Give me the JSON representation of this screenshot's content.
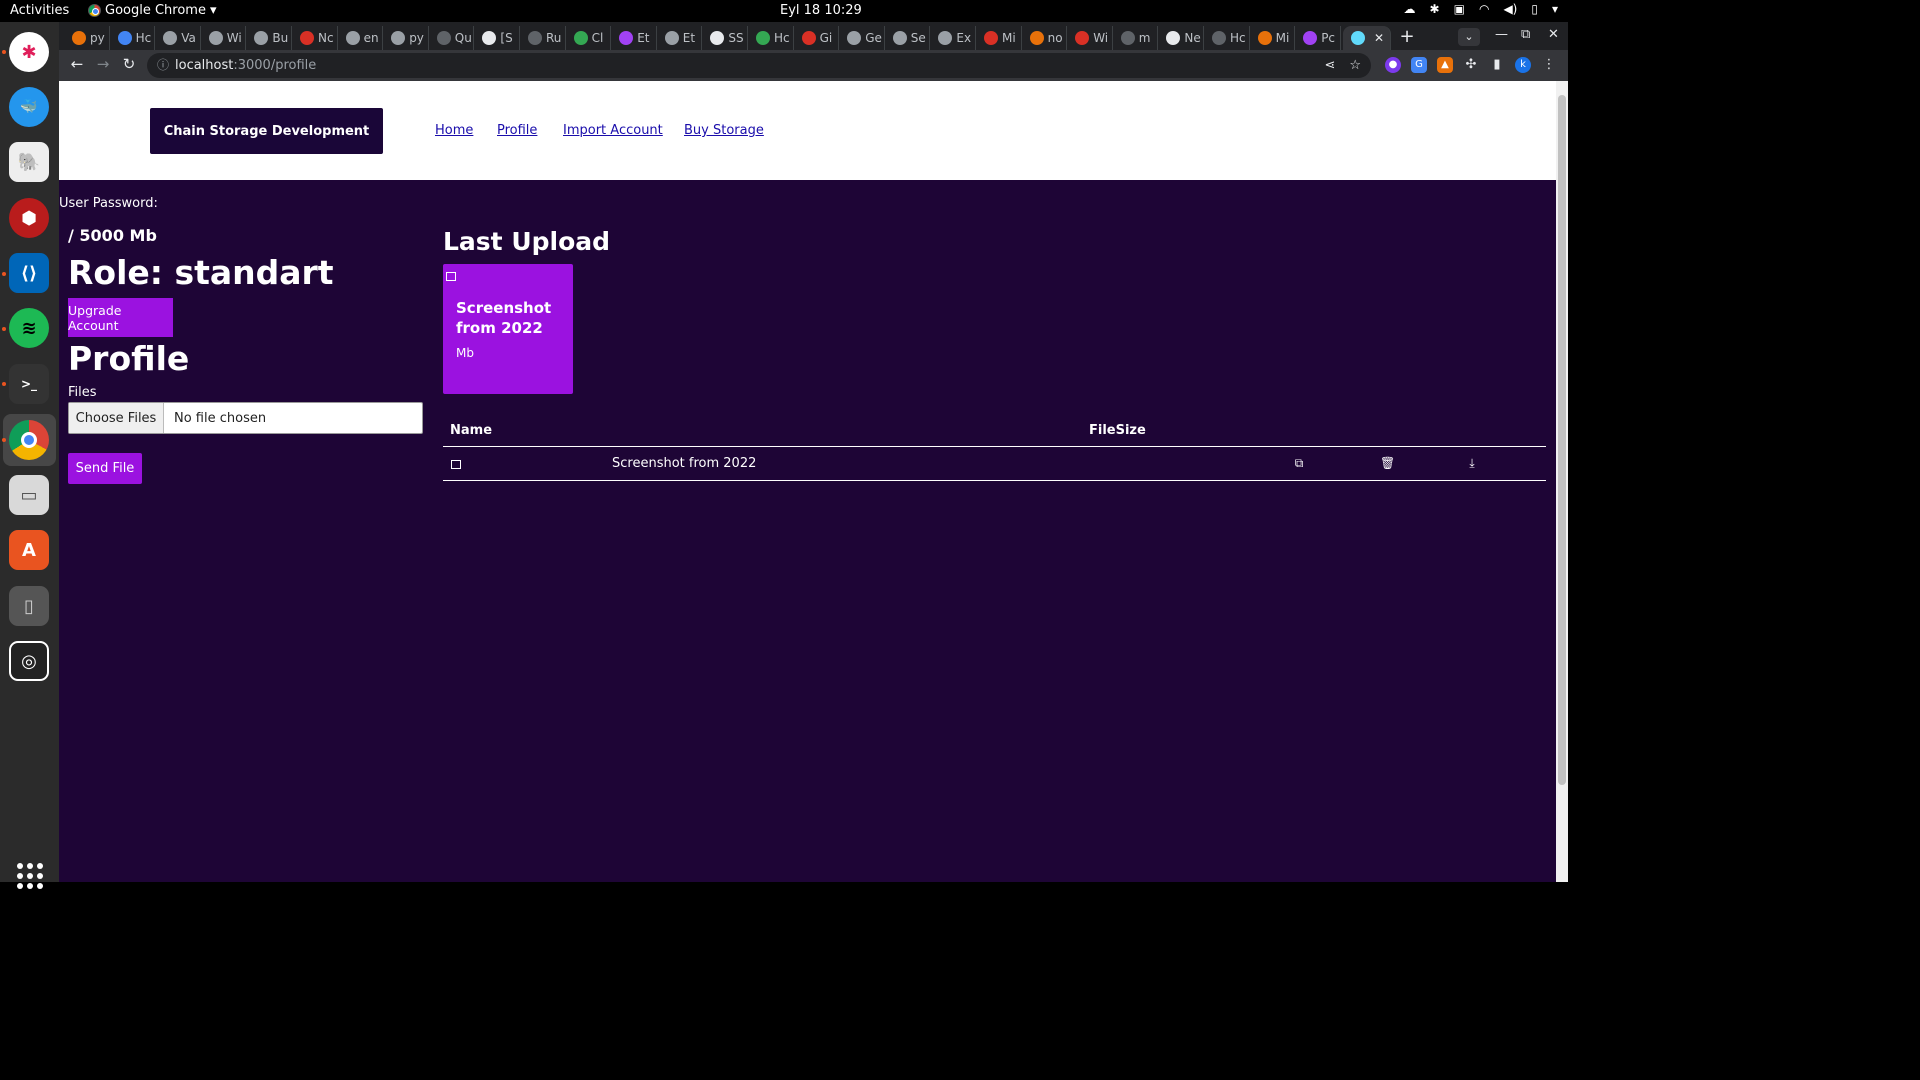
{
  "topbar": {
    "activities": "Activities",
    "app_name": "Google Chrome",
    "clock": "Eyl 18  10:29"
  },
  "browser": {
    "tabs": [
      {
        "label": "py",
        "color": "#e8710a"
      },
      {
        "label": "Hc",
        "color": "#4285f4"
      },
      {
        "label": "Va",
        "color": "#9aa0a6"
      },
      {
        "label": "Wi",
        "color": "#9aa0a6"
      },
      {
        "label": "Bu",
        "color": "#9aa0a6"
      },
      {
        "label": "Nc",
        "color": "#d93025"
      },
      {
        "label": "en",
        "color": "#9aa0a6"
      },
      {
        "label": "py",
        "color": "#9aa0a6"
      },
      {
        "label": "Qu",
        "color": "#5f6368"
      },
      {
        "label": "[S",
        "color": "#e8eaed"
      },
      {
        "label": "Ru",
        "color": "#5f6368"
      },
      {
        "label": "Cl",
        "color": "#34a853"
      },
      {
        "label": "Et",
        "color": "#a142f4"
      },
      {
        "label": "Et",
        "color": "#9aa0a6"
      },
      {
        "label": "SS",
        "color": "#e8eaed"
      },
      {
        "label": "Hc",
        "color": "#34a853"
      },
      {
        "label": "Gi",
        "color": "#d93025"
      },
      {
        "label": "Ge",
        "color": "#9aa0a6"
      },
      {
        "label": "Se",
        "color": "#9aa0a6"
      },
      {
        "label": "Ex",
        "color": "#9aa0a6"
      },
      {
        "label": "Mi",
        "color": "#d93025"
      },
      {
        "label": "no",
        "color": "#e8710a"
      },
      {
        "label": "Wi",
        "color": "#d93025"
      },
      {
        "label": "m",
        "color": "#5f6368"
      },
      {
        "label": "Ne",
        "color": "#e8eaed"
      },
      {
        "label": "Hc",
        "color": "#5f6368"
      },
      {
        "label": "Mi",
        "color": "#e8710a"
      },
      {
        "label": "Pc",
        "color": "#a142f4"
      }
    ],
    "active_tab_color": "#61dafb",
    "url_host": "localhost",
    "url_path": ":3000/profile",
    "profile_initial": "k"
  },
  "nav": {
    "brand": "Chain Storage Development",
    "links": [
      "Home",
      "Profile",
      "Import Account",
      "Buy Storage"
    ]
  },
  "profile": {
    "password_label": "User Password:",
    "quota": "/ 5000 Mb",
    "role": "Role: standart",
    "upgrade_button": "Upgrade Account",
    "title": "Profile",
    "files_label": "Files",
    "choose_button": "Choose Files",
    "no_file": "No file chosen",
    "send_button": "Send File"
  },
  "last_upload": {
    "title": "Last Upload",
    "card_name": "Screenshot from 2022",
    "card_size": "Mb"
  },
  "table": {
    "col_name": "Name",
    "col_size": "FileSize",
    "rows": [
      {
        "name": "Screenshot from 2022"
      }
    ]
  },
  "colors": {
    "page_bg": "#1e0536",
    "accent": "#9b12e0",
    "brand_bg": "#1a0638"
  }
}
